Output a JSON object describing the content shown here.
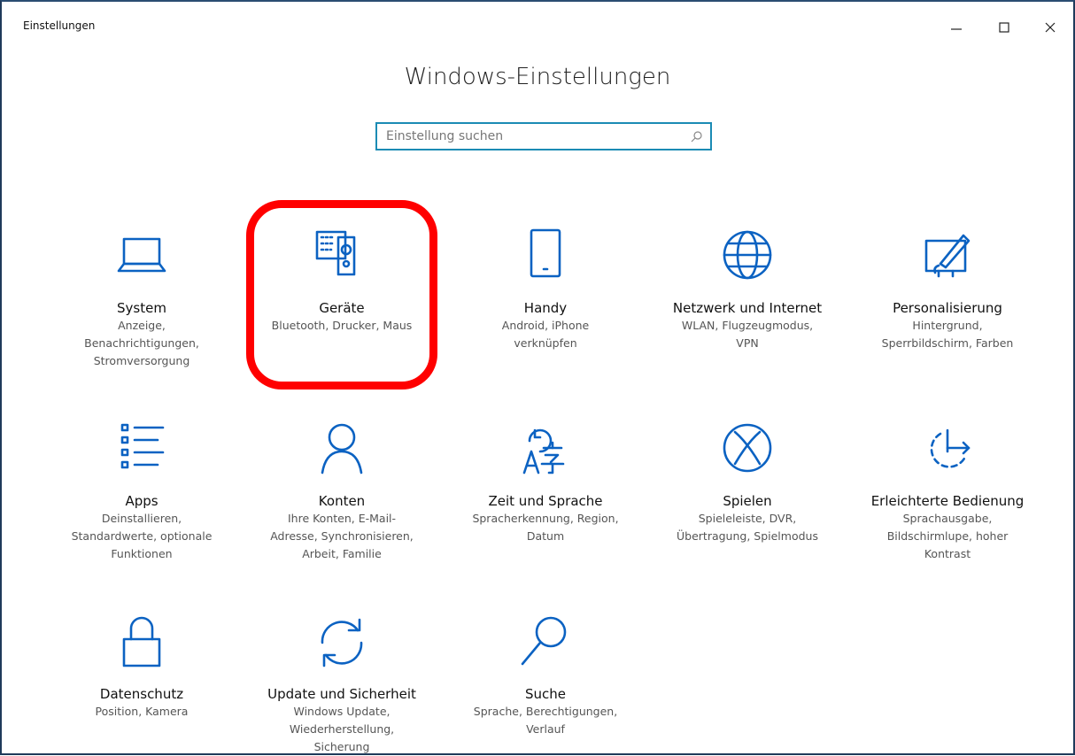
{
  "window": {
    "title": "Einstellungen"
  },
  "heading": "Windows-Einstellungen",
  "search": {
    "placeholder": "Einstellung suchen"
  },
  "tiles": [
    {
      "title": "System",
      "desc": "Anzeige,\nBenachrichtigungen,\nStromversorgung",
      "icon": "laptop-icon"
    },
    {
      "title": "Geräte",
      "desc": "Bluetooth, Drucker, Maus",
      "icon": "devices-icon"
    },
    {
      "title": "Handy",
      "desc": "Android, iPhone\nverknüpfen",
      "icon": "phone-icon"
    },
    {
      "title": "Netzwerk und Internet",
      "desc": "WLAN, Flugzeugmodus,\nVPN",
      "icon": "globe-icon"
    },
    {
      "title": "Personalisierung",
      "desc": "Hintergrund,\nSperrbildschirm, Farben",
      "icon": "paint-icon"
    },
    {
      "title": "Apps",
      "desc": "Deinstallieren,\nStandardwerte, optionale\nFunktionen",
      "icon": "apps-list-icon"
    },
    {
      "title": "Konten",
      "desc": "Ihre Konten, E-Mail-\nAdresse, Synchronisieren,\nArbeit, Familie",
      "icon": "person-icon"
    },
    {
      "title": "Zeit und Sprache",
      "desc": "Spracherkennung, Region,\nDatum",
      "icon": "time-language-icon"
    },
    {
      "title": "Spielen",
      "desc": "Spieleleiste, DVR,\nÜbertragung, Spielmodus",
      "icon": "xbox-icon"
    },
    {
      "title": "Erleichterte Bedienung",
      "desc": "Sprachausgabe,\nBildschirmlupe, hoher\nKontrast",
      "icon": "ease-of-access-icon"
    },
    {
      "title": "Datenschutz",
      "desc": "Position, Kamera",
      "icon": "lock-icon"
    },
    {
      "title": "Update und Sicherheit",
      "desc": "Windows Update,\nWiederherstellung,\nSicherung",
      "icon": "sync-icon"
    },
    {
      "title": "Suche",
      "desc": "Sprache, Berechtigungen,\nVerlauf",
      "icon": "search-icon"
    }
  ],
  "colors": {
    "accent": "#0b62c2",
    "highlight": "#ff0000",
    "search_border": "#1b8bb4"
  }
}
